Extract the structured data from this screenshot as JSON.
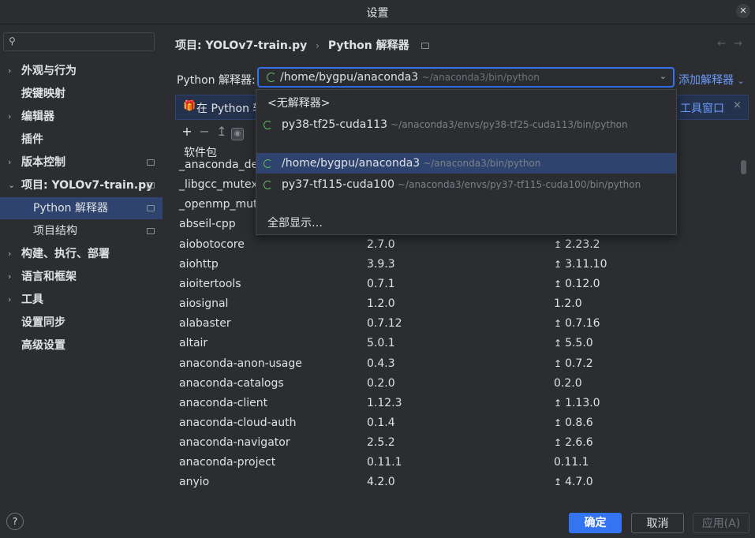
{
  "window": {
    "title": "设置"
  },
  "search": {
    "placeholder": ""
  },
  "sidebar": {
    "items": [
      {
        "label": "外观与行为",
        "arrow": "›"
      },
      {
        "label": "按键映射"
      },
      {
        "label": "编辑器",
        "arrow": "›"
      },
      {
        "label": "插件"
      },
      {
        "label": "版本控制",
        "arrow": "›"
      },
      {
        "label": "项目: YOLOv7-train.py",
        "arrow": "⌄"
      },
      {
        "label": "Python 解释器"
      },
      {
        "label": "项目结构"
      },
      {
        "label": "构建、执行、部署",
        "arrow": "›"
      },
      {
        "label": "语言和框架",
        "arrow": "›"
      },
      {
        "label": "工具",
        "arrow": "›"
      },
      {
        "label": "设置同步"
      },
      {
        "label": "高级设置"
      }
    ],
    "help": "?"
  },
  "breadcrumb": {
    "project": "项目: YOLOv7-train.py",
    "sep": "›",
    "page": "Python 解释器"
  },
  "nav": {
    "back": "←",
    "forward": "→"
  },
  "interpreter": {
    "label": "Python 解释器:",
    "selected_name": "/home/bygpu/anaconda3",
    "selected_path": "~/anaconda3/bin/python",
    "add_label": "添加解释器"
  },
  "banner": {
    "text": "在 Python 软",
    "link": "工具窗口",
    "close": "×"
  },
  "toolbar": {
    "add": "+",
    "remove": "−",
    "upgrade": "↥",
    "eye": "◉"
  },
  "table": {
    "header": "软件包",
    "rows": [
      {
        "name": "_anaconda_dep",
        "version": "",
        "latest": ""
      },
      {
        "name": "_libgcc_mutex",
        "version": "",
        "latest": ""
      },
      {
        "name": "_openmp_mut",
        "version": "",
        "latest": ""
      },
      {
        "name": "abseil-cpp",
        "version": "",
        "latest": ""
      },
      {
        "name": "aiobotocore",
        "version": "2.7.0",
        "latest": "2.23.2",
        "upgrade": true
      },
      {
        "name": "aiohttp",
        "version": "3.9.3",
        "latest": "3.11.10",
        "upgrade": true
      },
      {
        "name": "aioitertools",
        "version": "0.7.1",
        "latest": "0.12.0",
        "upgrade": true
      },
      {
        "name": "aiosignal",
        "version": "1.2.0",
        "latest": "1.2.0",
        "upgrade": false
      },
      {
        "name": "alabaster",
        "version": "0.7.12",
        "latest": "0.7.16",
        "upgrade": true
      },
      {
        "name": "altair",
        "version": "5.0.1",
        "latest": "5.5.0",
        "upgrade": true
      },
      {
        "name": "anaconda-anon-usage",
        "version": "0.4.3",
        "latest": "0.7.2",
        "upgrade": true
      },
      {
        "name": "anaconda-catalogs",
        "version": "0.2.0",
        "latest": "0.2.0",
        "upgrade": false
      },
      {
        "name": "anaconda-client",
        "version": "1.12.3",
        "latest": "1.13.0",
        "upgrade": true
      },
      {
        "name": "anaconda-cloud-auth",
        "version": "0.1.4",
        "latest": "0.8.6",
        "upgrade": true
      },
      {
        "name": "anaconda-navigator",
        "version": "2.5.2",
        "latest": "2.6.6",
        "upgrade": true
      },
      {
        "name": "anaconda-project",
        "version": "0.11.1",
        "latest": "0.11.1",
        "upgrade": false
      },
      {
        "name": "anyio",
        "version": "4.2.0",
        "latest": "4.7.0",
        "upgrade": true
      }
    ]
  },
  "dropdown": {
    "none_label": "<无解释器>",
    "options": [
      {
        "name": "py38-tf25-cuda113",
        "path": "~/anaconda3/envs/py38-tf25-cuda113/bin/python"
      },
      {
        "name": "/home/bygpu/anaconda3",
        "path": "~/anaconda3/bin/python"
      },
      {
        "name": "py37-tf115-cuda100",
        "path": "~/anaconda3/envs/py37-tf115-cuda100/bin/python"
      }
    ],
    "show_all": "全部显示…"
  },
  "footer": {
    "ok": "确定",
    "cancel": "取消",
    "apply": "应用(A)"
  },
  "colors": {
    "accent": "#3574f0",
    "selection": "#2e436e",
    "link": "#6b9bfa",
    "background": "#2b2d30"
  }
}
